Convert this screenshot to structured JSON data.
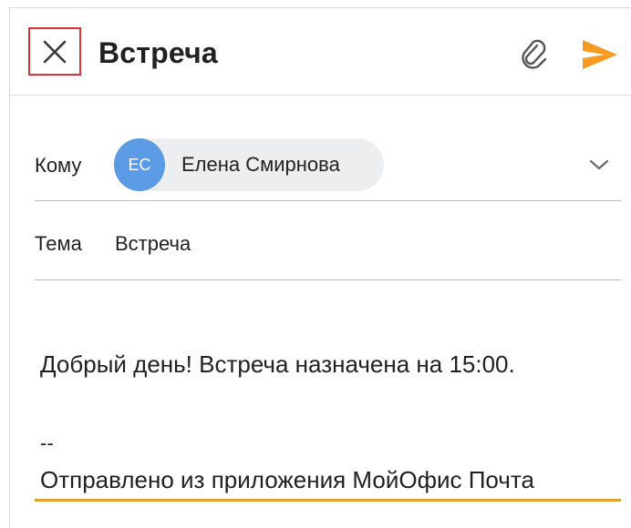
{
  "header": {
    "title": "Встреча",
    "close_icon": "close-icon",
    "attach_icon": "paperclip-icon",
    "send_icon": "send-icon",
    "accent": "#f59b23"
  },
  "to": {
    "label": "Кому",
    "recipients": [
      {
        "initials": "ЕС",
        "name": "Елена Смирнова",
        "avatar_color": "#5b9be6"
      }
    ],
    "expand_icon": "chevron-down-icon"
  },
  "subject": {
    "label": "Тема",
    "value": "Встреча"
  },
  "message": {
    "body": "Добрый день! Встреча назначена на 15:00.",
    "signature_separator": "--",
    "signature": "Отправлено из приложения МойОфис Почта",
    "focus_color": "#e0a12a"
  }
}
